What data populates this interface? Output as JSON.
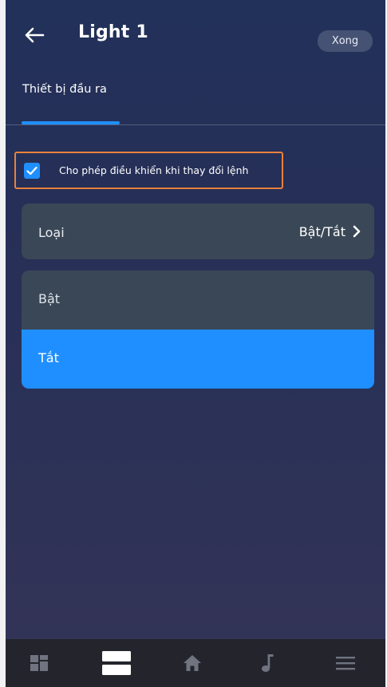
{
  "header": {
    "title": "Light 1",
    "done_label": "Xong",
    "tab_label": "Thiết bị đầu ra",
    "back_icon": "arrow-left-icon"
  },
  "permission": {
    "label": "Cho phép điều khiển khi thay đổi lệnh",
    "checked": true
  },
  "type_row": {
    "label": "Loại",
    "value": "Bật/Tắt"
  },
  "options": [
    {
      "label": "Bật",
      "selected": false
    },
    {
      "label": "Tắt",
      "selected": true
    }
  ],
  "bottom_nav": [
    {
      "icon": "dashboard-icon",
      "active": false
    },
    {
      "icon": "devices-icon",
      "active": true
    },
    {
      "icon": "home-icon",
      "active": false
    },
    {
      "icon": "music-icon",
      "active": false
    },
    {
      "icon": "menu-icon",
      "active": false
    }
  ],
  "colors": {
    "accent": "#1f8fff",
    "highlight_border": "#e9813a",
    "row_bg": "#3a4756",
    "nav_bg": "#24252c"
  }
}
